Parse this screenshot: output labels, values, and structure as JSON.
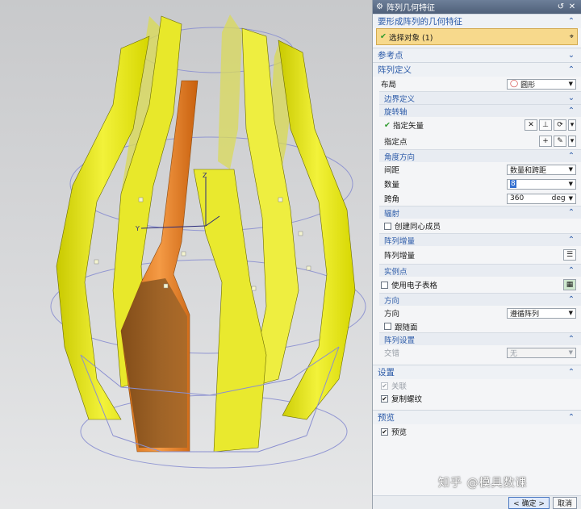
{
  "dialog": {
    "title": "阵列几何特征",
    "sections": {
      "features": {
        "label": "要形成阵列的几何特征",
        "select_label": "选择对象 (1)"
      },
      "ref_point": {
        "label": "参考点"
      },
      "pattern_def": {
        "label": "阵列定义",
        "layout_label": "布局",
        "layout_value": "圆形",
        "boundary_label": "边界定义",
        "rotation_axis": {
          "label": "旋转轴",
          "vector_label": "指定矢量",
          "point_label": "指定点"
        },
        "angle_dir": {
          "label": "角度方向",
          "spacing_label": "间距",
          "spacing_value": "数量和跨距",
          "count_label": "数量",
          "count_value": "8",
          "span_label": "跨角",
          "span_value": "360",
          "span_unit": "deg"
        },
        "radiate": {
          "label": "辐射",
          "concentric_label": "创建同心成员"
        },
        "increment": {
          "label": "阵列增量",
          "row_label": "阵列增量"
        },
        "instance": {
          "label": "实例点",
          "spreadsheet_label": "使用电子表格"
        },
        "orientation": {
          "label": "方向",
          "dir_label": "方向",
          "dir_value": "遵循阵列",
          "follow_label": "跟随面"
        },
        "pattern_settings": {
          "label": "阵列设置",
          "stagger_label": "交错",
          "stagger_value": "无"
        }
      },
      "settings": {
        "label": "设置",
        "assoc_label": "关联",
        "copy_thread_label": "复制螺纹"
      },
      "preview": {
        "label": "预览",
        "preview_label": "预览"
      }
    },
    "buttons": {
      "ok": "< 确定 >",
      "cancel": "取消"
    }
  },
  "watermark": "知乎 @模具数课",
  "colors": {
    "accent": "#2b5aa8",
    "highlight": "#f7d98c",
    "yellow_body": "#e6e600",
    "orange_rib": "#e27a1a"
  }
}
